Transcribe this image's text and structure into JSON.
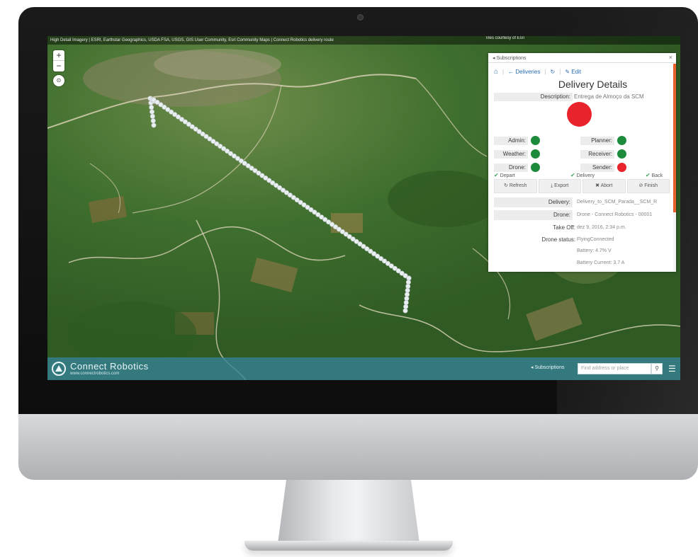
{
  "map": {
    "attribution": "High Detail Imagery | ESRI, Earthstar Geographics, USDA FSA, USGS, GIS User Community, Esri Community Maps | Connect Robotics delivery route",
    "attribution_right": "Tiles courtesy of Esri"
  },
  "map_controls": {
    "zoom_in": "+",
    "zoom_out": "−",
    "compass": "⊙"
  },
  "bottom_bar": {
    "brand": "Connect Robotics",
    "brand_url": "www.connectrobotics.com",
    "subscriptions_button": "◂ Subscriptions",
    "search_placeholder": "Find address or place",
    "search_icon": "search-icon",
    "menu_icon": "menu-icon"
  },
  "panel": {
    "header_title": "◂ Subscriptions",
    "close": "×",
    "nav": {
      "home": "⌂",
      "back": "← Deliveries",
      "refresh": "↻",
      "edit": "✎ Edit"
    },
    "title": "Delivery Details",
    "description_label": "Description:",
    "description_value": "Entrega de Almoço da SCM",
    "status_color": "#e8232b",
    "statuses": [
      {
        "label": "Admin:",
        "state": "green"
      },
      {
        "label": "Weather:",
        "state": "green"
      },
      {
        "label": "Drone:",
        "state": "green"
      },
      {
        "label": "Planner:",
        "state": "green"
      },
      {
        "label": "Receiver:",
        "state": "green"
      },
      {
        "label": "Sender:",
        "state": "red"
      }
    ],
    "phases": [
      "Depart",
      "Delivery",
      "Back"
    ],
    "actions": [
      "↻ Refresh",
      "⤓ Export",
      "✖ Abort",
      "⊘ Finish"
    ],
    "info": [
      {
        "label": "Delivery:",
        "value": "Delivery_to_SCM_Parada__SCM_R"
      },
      {
        "label": "Drone:",
        "value": "Drone - Connect Robotics - 00001"
      },
      {
        "label": "Take Off:",
        "value": "dez 9, 2016, 2:34 p.m."
      },
      {
        "label": "Drone status:",
        "value": "FlyingConnected"
      }
    ],
    "extra_lines": [
      "Battery: 4.7% V",
      "Battery Current: 3.7 A"
    ]
  }
}
